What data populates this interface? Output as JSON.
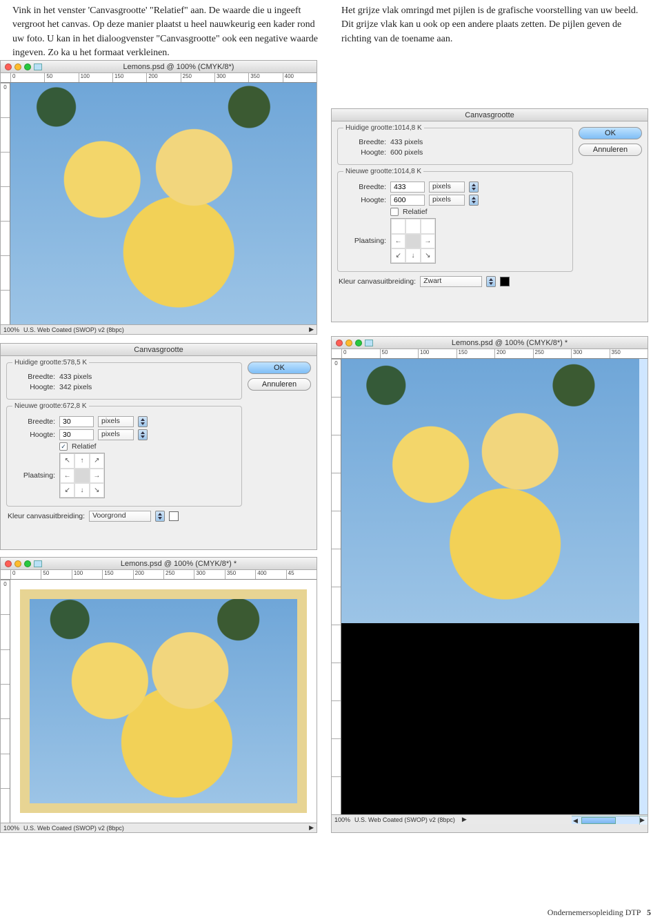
{
  "text": {
    "left_para": "Vink in het venster 'Canvasgrootte' \"Relatief\" aan. De waarde die u ingeeft vergroot het canvas. Op deze manier plaatst u heel nauwkeurig een kader rond uw foto. U kan in het dialoogvenster \"Canvasgrootte\" ook een negative waarde ingeven. Zo ka u het formaat verkleinen.",
    "right_para": "Het grijze vlak omringd met pijlen is de grafische voorstelling van uw beeld. Dit grijze vlak kan u ook op een andere plaats zetten. De pijlen geven de richting van de toename aan."
  },
  "ruler": {
    "h1": [
      "0",
      "50",
      "100",
      "150",
      "200",
      "250",
      "300",
      "350",
      "400"
    ],
    "h2": [
      "0",
      "50",
      "100",
      "150",
      "200",
      "250",
      "300",
      "350",
      "400",
      "45"
    ],
    "h3": [
      "0",
      "50",
      "100",
      "150",
      "200",
      "250",
      "300",
      "350"
    ],
    "v": [
      "0",
      " ",
      " ",
      " ",
      " ",
      " ",
      " "
    ]
  },
  "win1": {
    "title": "Lemons.psd @ 100% (CMYK/8*)",
    "zoom": "100%",
    "profile": "U.S. Web Coated (SWOP) v2 (8bpc)"
  },
  "dlg1": {
    "title": "Canvasgrootte",
    "ok": "OK",
    "cancel": "Annuleren",
    "cur_label": "Huidige grootte:578,5 K",
    "breedte_lbl": "Breedte:",
    "breedte_cur": "433 pixels",
    "hoogte_lbl": "Hoogte:",
    "hoogte_cur": "342 pixels",
    "new_label": "Nieuwe grootte:672,8 K",
    "breedte_new": "30",
    "hoogte_new": "30",
    "unit": "pixels",
    "relatief": "Relatief",
    "plaatsing": "Plaatsing:",
    "kleurlabel": "Kleur canvasuitbreiding:",
    "kleur_val": "Voorgrond"
  },
  "win2": {
    "title": "Lemons.psd @ 100% (CMYK/8*) *",
    "zoom": "100%",
    "profile": "U.S. Web Coated (SWOP) v2 (8bpc)"
  },
  "dlg2": {
    "title": "Canvasgrootte",
    "ok": "OK",
    "cancel": "Annuleren",
    "cur_label": "Huidige grootte:1014,8 K",
    "breedte_lbl": "Breedte:",
    "breedte_cur": "433 pixels",
    "hoogte_lbl": "Hoogte:",
    "hoogte_cur": "600 pixels",
    "new_label": "Nieuwe grootte:1014,8 K",
    "breedte_new": "433",
    "hoogte_new": "600",
    "unit": "pixels",
    "relatief": "Relatief",
    "plaatsing": "Plaatsing:",
    "kleurlabel": "Kleur canvasuitbreiding:",
    "kleur_val": "Zwart"
  },
  "win3": {
    "title": "Lemons.psd @ 100% (CMYK/8*) *",
    "zoom": "100%",
    "profile": "U.S. Web Coated (SWOP) v2 (8bpc)"
  },
  "footer": {
    "text": "Ondernemersopleiding DTP",
    "page": "5"
  }
}
